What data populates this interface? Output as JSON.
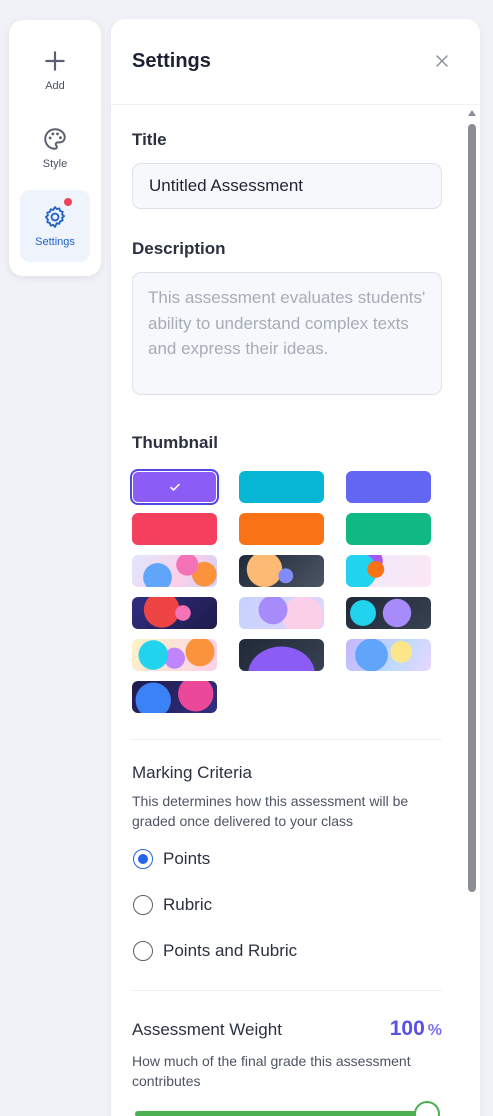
{
  "rail": {
    "items": [
      {
        "label": "Add",
        "icon": "plus-icon"
      },
      {
        "label": "Style",
        "icon": "palette-icon"
      },
      {
        "label": "Settings",
        "icon": "gear-icon",
        "active": true,
        "has_notification": true
      }
    ]
  },
  "panel": {
    "title": "Settings"
  },
  "title_section": {
    "label": "Title",
    "value": "Untitled Assessment"
  },
  "description_section": {
    "label": "Description",
    "placeholder": "This assessment evaluates students' ability to understand complex texts and express their ideas."
  },
  "thumbnail_section": {
    "label": "Thumbnail",
    "selected_index": 0,
    "options": [
      {
        "kind": "solid",
        "color": "#8b5cf6"
      },
      {
        "kind": "solid",
        "color": "#06b6d4"
      },
      {
        "kind": "solid",
        "color": "#6366f1"
      },
      {
        "kind": "solid",
        "color": "#f43f5e"
      },
      {
        "kind": "solid",
        "color": "#f97316"
      },
      {
        "kind": "solid",
        "color": "#10b981"
      },
      {
        "kind": "image",
        "name": "abstract-pastel-1"
      },
      {
        "kind": "image",
        "name": "abstract-dark-1"
      },
      {
        "kind": "image",
        "name": "abstract-pastel-2"
      },
      {
        "kind": "image",
        "name": "abstract-dark-2"
      },
      {
        "kind": "image",
        "name": "abstract-pastel-3"
      },
      {
        "kind": "image",
        "name": "abstract-dark-3"
      },
      {
        "kind": "image",
        "name": "abstract-pastel-4"
      },
      {
        "kind": "image",
        "name": "abstract-dark-4"
      },
      {
        "kind": "image",
        "name": "abstract-pastel-5"
      },
      {
        "kind": "image",
        "name": "abstract-dark-5"
      }
    ]
  },
  "marking_section": {
    "label": "Marking Criteria",
    "description": "This determines how this assessment will be graded once delivered to your class",
    "options": [
      {
        "label": "Points",
        "checked": true
      },
      {
        "label": "Rubric",
        "checked": false
      },
      {
        "label": "Points and Rubric",
        "checked": false
      }
    ]
  },
  "weight_section": {
    "label": "Assessment Weight",
    "value": "100",
    "unit": "%",
    "description": "How much of the final grade this assessment contributes",
    "slider_fraction": 1.0
  },
  "colors": {
    "accent": "#2463eb",
    "weight_accent": "#5b4ee6",
    "slider": "#4caf50",
    "notification": "#f04358"
  }
}
